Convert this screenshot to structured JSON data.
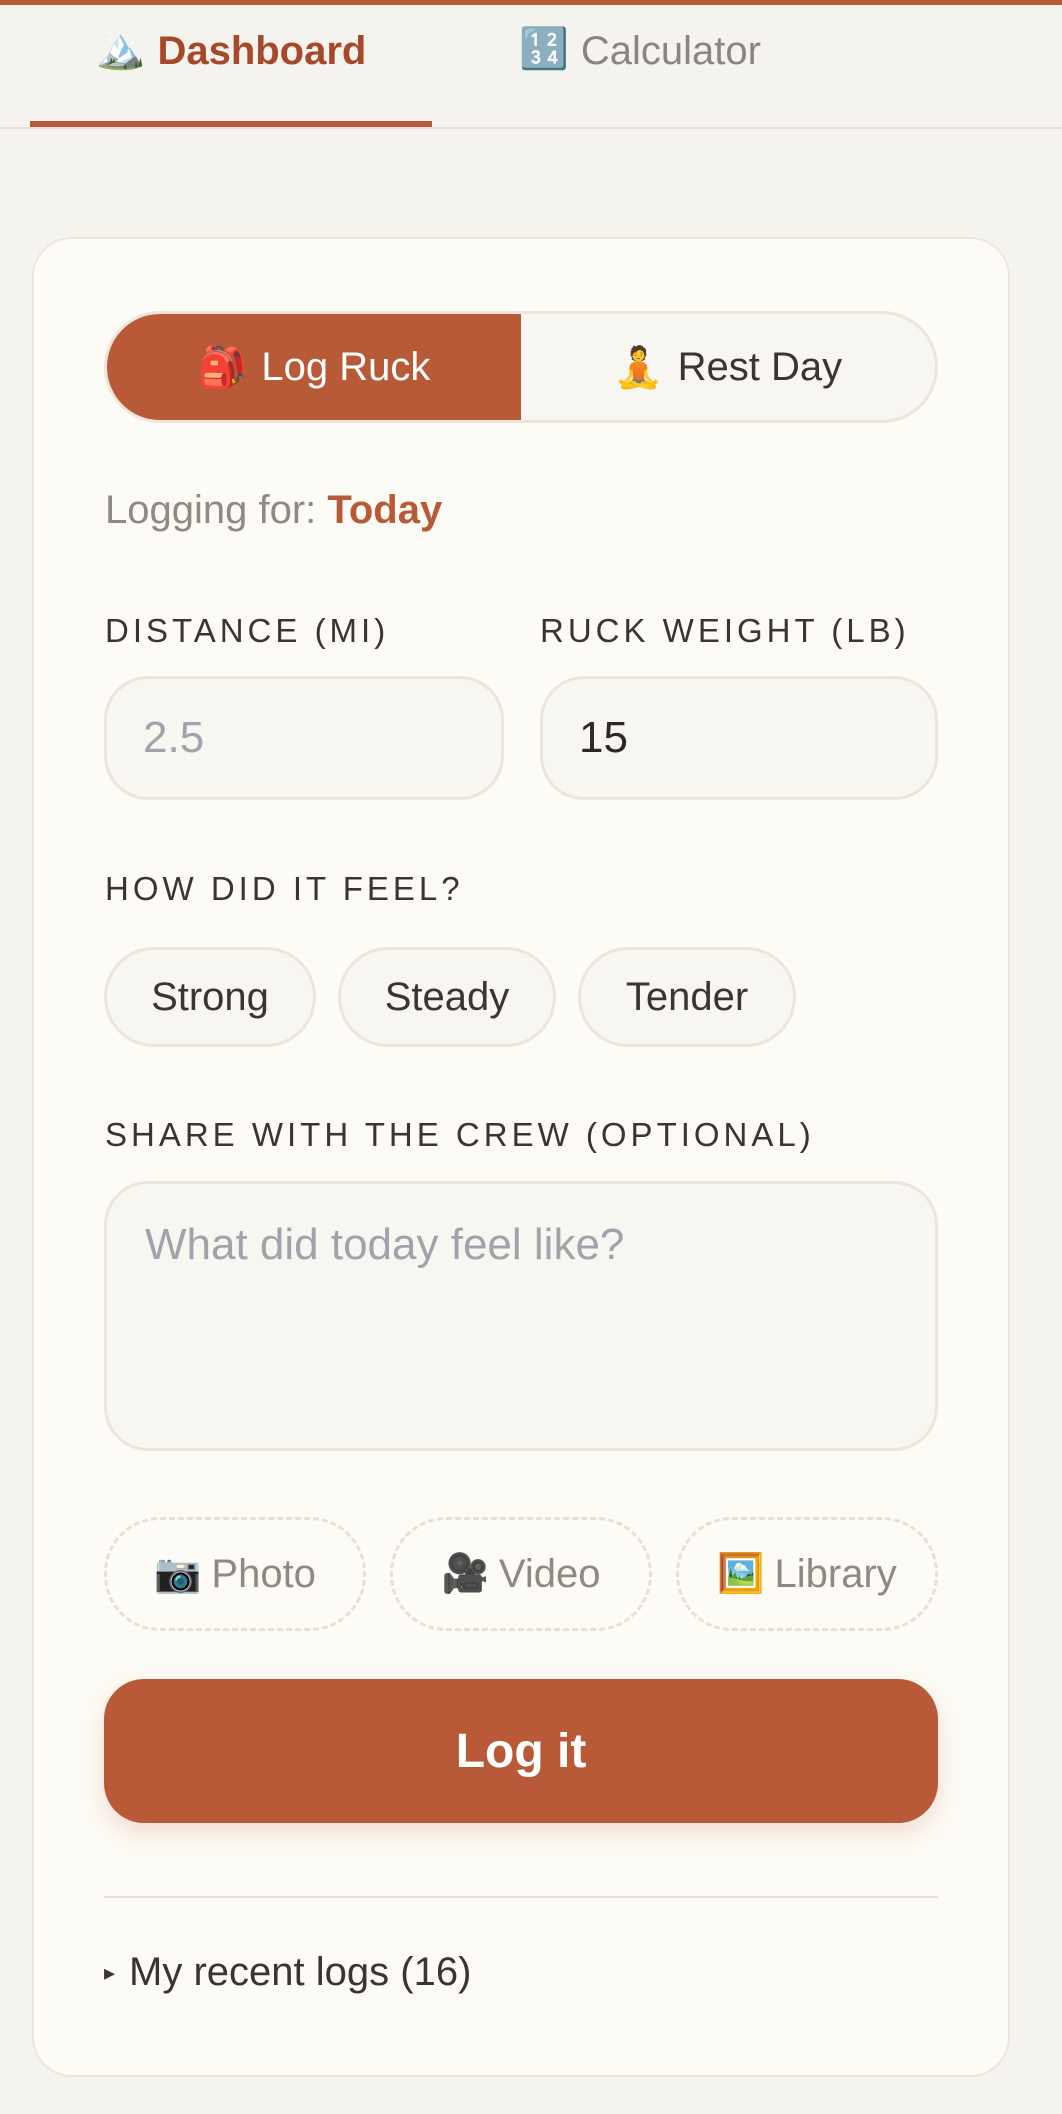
{
  "tabs": [
    {
      "icon": "🏔️",
      "label": "Dashboard",
      "active": true
    },
    {
      "icon": "🔢",
      "label": "Calculator",
      "active": false
    }
  ],
  "mode_toggle": {
    "log_ruck": {
      "icon": "🎒",
      "label": "Log Ruck",
      "selected": true
    },
    "rest_day": {
      "icon": "🧘",
      "label": "Rest Day",
      "selected": false
    }
  },
  "logging_for": {
    "prefix": "Logging for:",
    "value": "Today"
  },
  "distance": {
    "label": "DISTANCE (MI)",
    "placeholder": "2.5",
    "value": ""
  },
  "ruck_weight": {
    "label": "RUCK WEIGHT (LB)",
    "value": "15"
  },
  "feel": {
    "label": "HOW DID IT FEEL?",
    "options": [
      "Strong",
      "Steady",
      "Tender"
    ]
  },
  "share": {
    "label": "SHARE WITH THE CREW (OPTIONAL)",
    "placeholder": "What did today feel like?"
  },
  "media": [
    {
      "icon": "📷",
      "label": "Photo"
    },
    {
      "icon": "🎥",
      "label": "Video"
    },
    {
      "icon": "🖼️",
      "label": "Library"
    }
  ],
  "submit_label": "Log it",
  "recent": {
    "label": "My recent logs (16)",
    "marker": "▸"
  },
  "colors": {
    "accent": "#b85a37",
    "background": "#f5f3ee",
    "card": "#fdfbf5"
  }
}
